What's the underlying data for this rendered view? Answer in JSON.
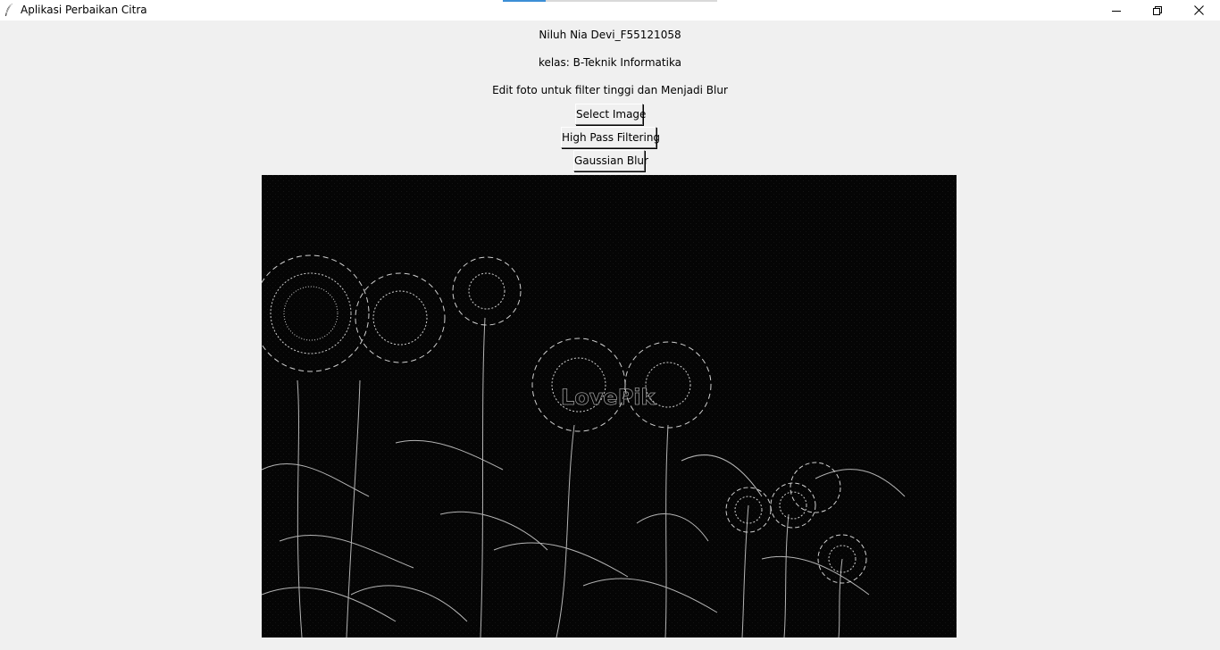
{
  "window": {
    "title": "Aplikasi Perbaikan Citra",
    "icon": "feather-icon",
    "controls": {
      "minimize": "minimize-icon",
      "maximize": "restore-icon",
      "close": "close-icon"
    }
  },
  "labels": {
    "name": "Niluh Nia Devi_F55121058",
    "class": "kelas: B-Teknik Informatika",
    "description": "Edit foto untuk filter tinggi dan Menjadi Blur"
  },
  "buttons": {
    "select_image": "Select Image",
    "high_pass": "High Pass Filtering",
    "gaussian_blur": "Gaussian Blur"
  },
  "image": {
    "subject": "sunflowers",
    "filter_applied": "high-pass",
    "watermark_text": "LovePik"
  },
  "colors": {
    "window_bg": "#f0f0f0",
    "titlebar_bg": "#ffffff",
    "image_bg": "#050505",
    "edge_stroke": "#cfcfcf"
  }
}
